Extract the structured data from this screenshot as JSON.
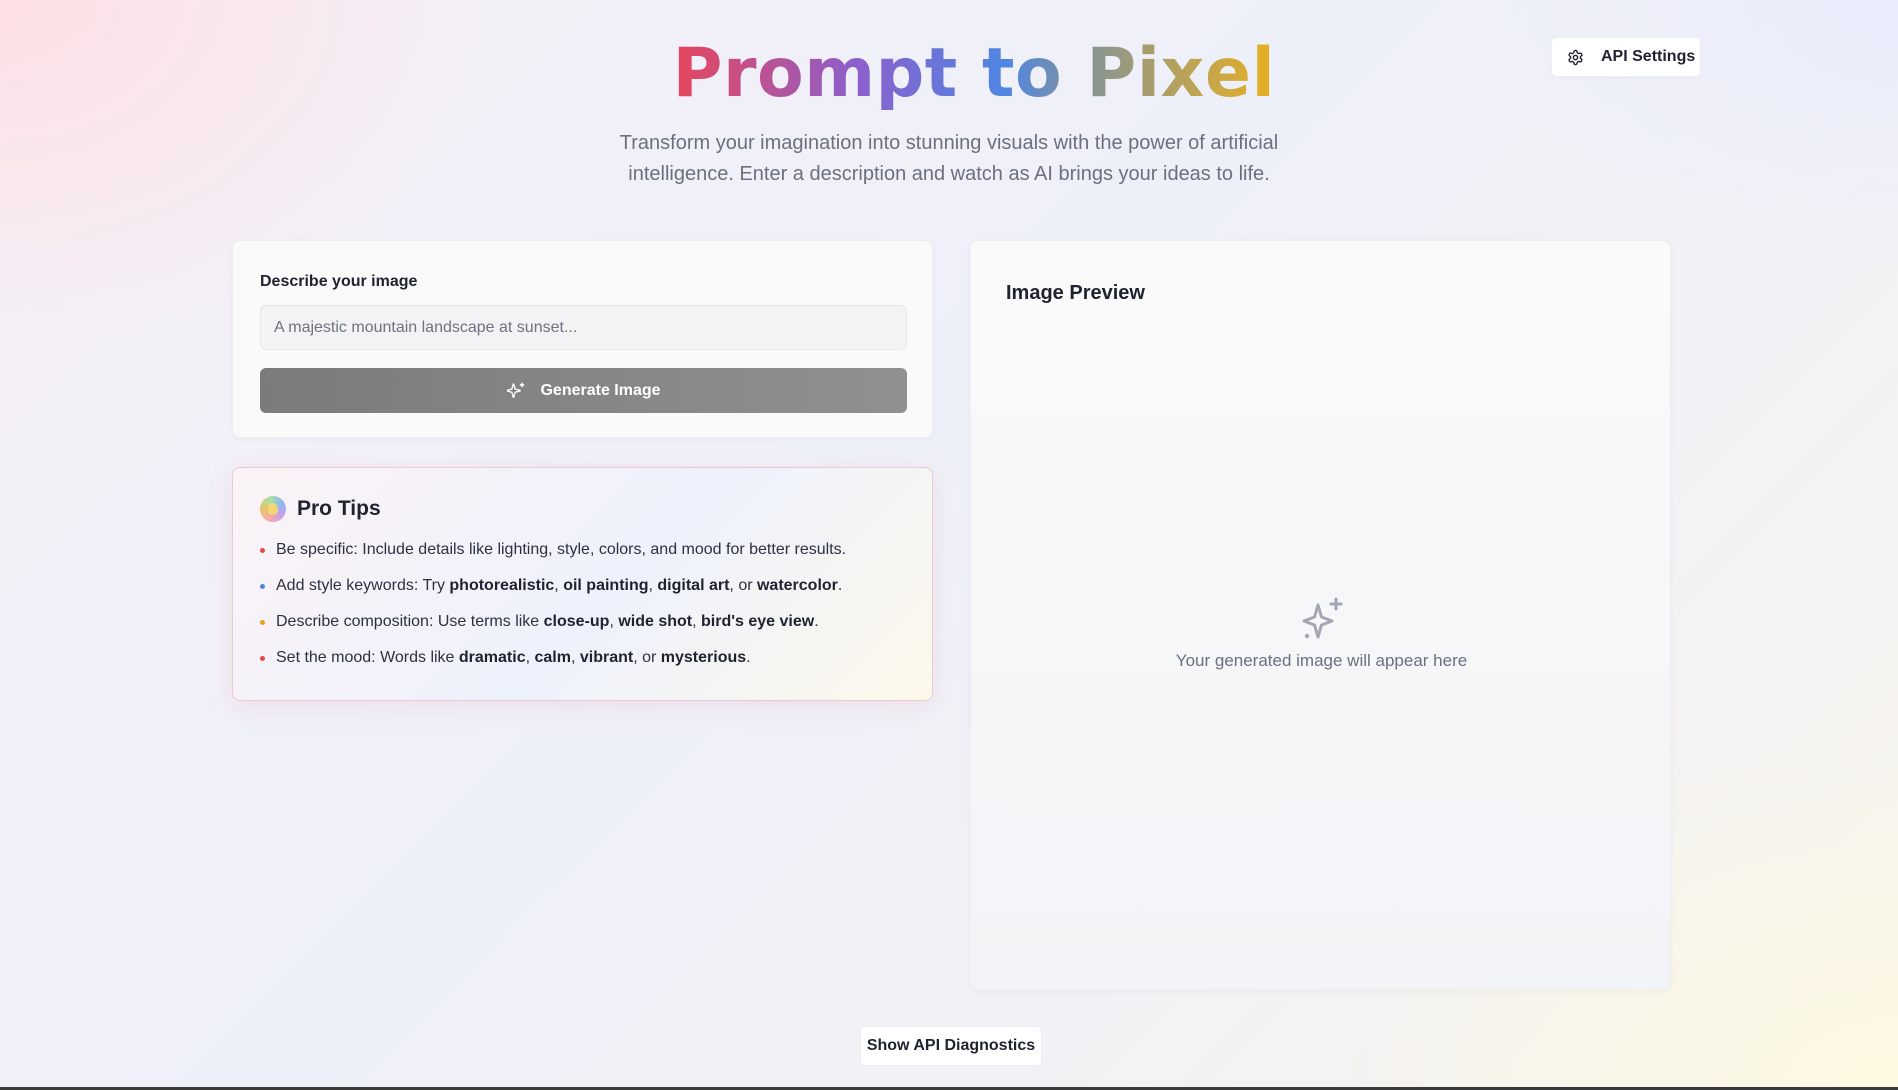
{
  "header": {
    "title": "Prompt to Pixel",
    "subtitle": "Transform your imagination into stunning visuals with the power of artificial intelligence. Enter a description and watch as AI brings your ideas to life."
  },
  "toolbar": {
    "api_settings_label": "API Settings",
    "api_settings_icon": "gear-icon"
  },
  "prompt": {
    "label": "Describe your image",
    "placeholder": "A majestic mountain landscape at sunset...",
    "value": "",
    "generate_label": "Generate Image",
    "generate_icon": "sparkles-icon"
  },
  "tips": {
    "title": "Pro Tips",
    "icon": "lightbulb-icon",
    "items": [
      {
        "bullet_color": "#e5484d",
        "parts": [
          {
            "text": "Be specific: Include details like lighting, style, colors, and mood for better results.",
            "bold": false
          }
        ]
      },
      {
        "bullet_color": "#4f86e2",
        "parts": [
          {
            "text": "Add style keywords: Try ",
            "bold": false
          },
          {
            "text": "photorealistic",
            "bold": true
          },
          {
            "text": ", ",
            "bold": false
          },
          {
            "text": "oil painting",
            "bold": true
          },
          {
            "text": ", ",
            "bold": false
          },
          {
            "text": "digital art",
            "bold": true
          },
          {
            "text": ", or ",
            "bold": false
          },
          {
            "text": "watercolor",
            "bold": true
          },
          {
            "text": ".",
            "bold": false
          }
        ]
      },
      {
        "bullet_color": "#e8a317",
        "parts": [
          {
            "text": "Describe composition: Use terms like ",
            "bold": false
          },
          {
            "text": "close-up",
            "bold": true
          },
          {
            "text": ", ",
            "bold": false
          },
          {
            "text": "wide shot",
            "bold": true
          },
          {
            "text": ", ",
            "bold": false
          },
          {
            "text": "bird's eye view",
            "bold": true
          },
          {
            "text": ".",
            "bold": false
          }
        ]
      },
      {
        "bullet_color": "#e5484d",
        "parts": [
          {
            "text": "Set the mood: Words like ",
            "bold": false
          },
          {
            "text": "dramatic",
            "bold": true
          },
          {
            "text": ", ",
            "bold": false
          },
          {
            "text": "calm",
            "bold": true
          },
          {
            "text": ", ",
            "bold": false
          },
          {
            "text": "vibrant",
            "bold": true
          },
          {
            "text": ", or ",
            "bold": false
          },
          {
            "text": "mysterious",
            "bold": true
          },
          {
            "text": ".",
            "bold": false
          }
        ]
      }
    ]
  },
  "preview": {
    "title": "Image Preview",
    "empty_message": "Your generated image will appear here",
    "empty_icon": "sparkles-icon"
  },
  "footer": {
    "diagnostics_label": "Show API Diagnostics"
  },
  "colors": {
    "title_gradient": [
      "#e8455a",
      "#8d5fcc",
      "#4f86e2",
      "#8a9590",
      "#e8b021"
    ],
    "generate_button": "#888888"
  }
}
